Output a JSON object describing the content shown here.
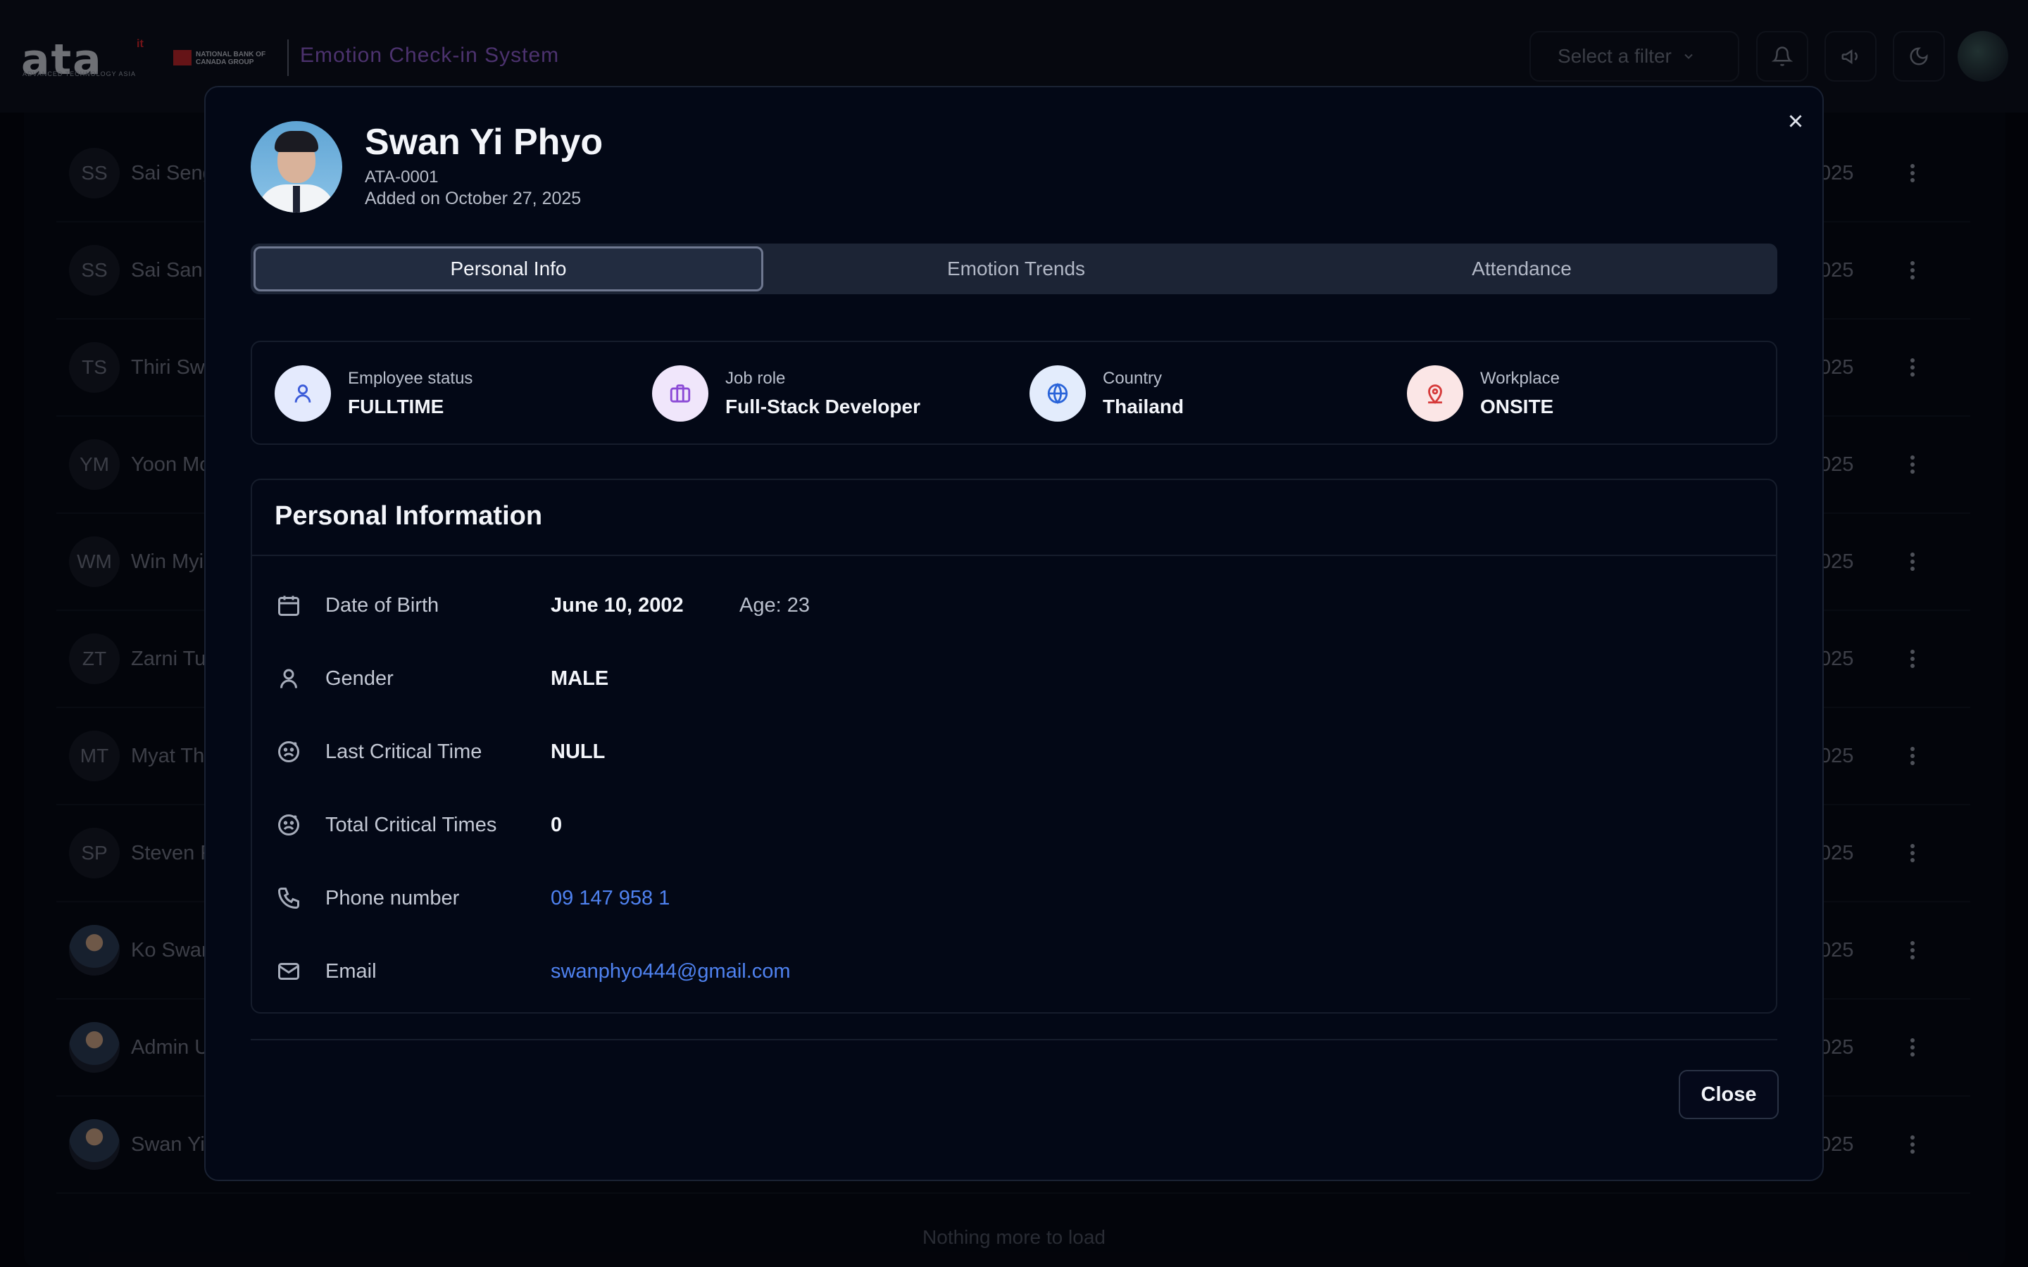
{
  "header": {
    "logo_text": "ata",
    "logo_suffix": "it",
    "logo_subtitle": "ADVANCED TECHNOLOGY ASIA",
    "partner_text": "NATIONAL BANK OF CANADA GROUP",
    "app_title": "Emotion Check-in System",
    "filter_placeholder": "Select a filter",
    "icons": [
      "bell-icon",
      "megaphone-icon",
      "moon-icon"
    ]
  },
  "list": {
    "rows": [
      {
        "initials": "SS",
        "name": "Sai Seng",
        "date": "025"
      },
      {
        "initials": "SS",
        "name": "Sai San",
        "date": "025"
      },
      {
        "initials": "TS",
        "name": "Thiri Sw",
        "date": "025"
      },
      {
        "initials": "YM",
        "name": "Yoon Mo",
        "date": "025"
      },
      {
        "initials": "WM",
        "name": "Win Myi",
        "date": "025"
      },
      {
        "initials": "ZT",
        "name": "Zarni Tu",
        "date": "025"
      },
      {
        "initials": "MT",
        "name": "Myat Th",
        "date": "025"
      },
      {
        "initials": "SP",
        "name": "Steven F",
        "date": "025"
      },
      {
        "initials": "",
        "name": "Ko Swar",
        "date": "025"
      },
      {
        "initials": "",
        "name": "Admin U",
        "date": "025"
      },
      {
        "initials": "",
        "name": "Swan Yi",
        "date": "025"
      }
    ],
    "footer": "Nothing more to load"
  },
  "modal": {
    "name": "Swan Yi Phyo",
    "employee_id": "ATA-0001",
    "added": "Added on October 27, 2025",
    "tabs": [
      {
        "label": "Personal Info",
        "active": true
      },
      {
        "label": "Emotion Trends",
        "active": false
      },
      {
        "label": "Attendance",
        "active": false
      }
    ],
    "cards": [
      {
        "label": "Employee status",
        "value": "FULLTIME",
        "icon": "user-icon",
        "color": "#3b5bd9",
        "bg": "#e4eafd"
      },
      {
        "label": "Job role",
        "value": "Full-Stack Developer",
        "icon": "briefcase-icon",
        "color": "#8b4ad6",
        "bg": "#f0e6fb"
      },
      {
        "label": "Country",
        "value": "Thailand",
        "icon": "globe-icon",
        "color": "#2a64d9",
        "bg": "#e3ecfc"
      },
      {
        "label": "Workplace",
        "value": "ONSITE",
        "icon": "map-pin-icon",
        "color": "#d63a3a",
        "bg": "#fbe6e6"
      }
    ],
    "section_title": "Personal Information",
    "fields": [
      {
        "label": "Date of Birth",
        "value": "June 10, 2002",
        "extra": "Age: 23",
        "icon": "calendar-icon"
      },
      {
        "label": "Gender",
        "value": "MALE",
        "icon": "user-icon"
      },
      {
        "label": "Last Critical Time",
        "value": "NULL",
        "icon": "sad-face-icon"
      },
      {
        "label": "Total Critical Times",
        "value": "0",
        "icon": "sad-face-icon"
      },
      {
        "label": "Phone number",
        "value": "09 147 958 1",
        "icon": "phone-icon",
        "link": true
      },
      {
        "label": "Email",
        "value": "swanphyo444@gmail.com",
        "icon": "mail-icon",
        "link": true
      }
    ],
    "close_label": "Close"
  }
}
